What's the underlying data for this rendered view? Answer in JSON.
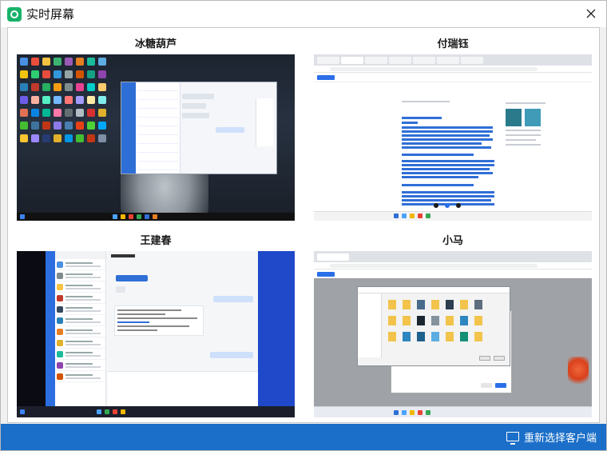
{
  "window": {
    "title": "实时屏幕"
  },
  "panels": [
    {
      "label": "冰糖葫芦"
    },
    {
      "label": "付瑞钰"
    },
    {
      "label": "王建春"
    },
    {
      "label": "小马"
    }
  ],
  "footer": {
    "reselect_label": "重新选择客户端"
  },
  "icons": {
    "app": "screen-share-icon",
    "close": "close-icon",
    "reselect": "monitor-icon"
  },
  "colors": {
    "accent": "#1b6fc8",
    "app_icon": "#17b26a"
  }
}
